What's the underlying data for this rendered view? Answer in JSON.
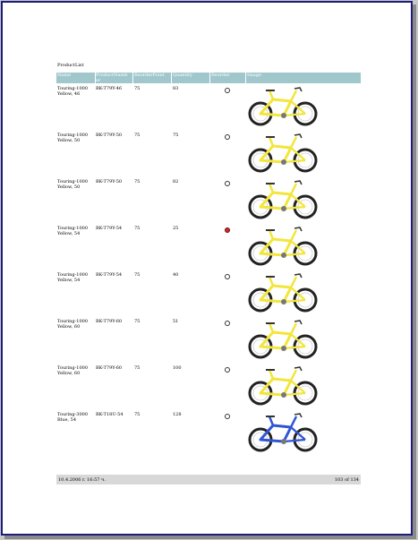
{
  "report": {
    "title": "ProductList",
    "columns": {
      "name": "Name",
      "product_number": "ProductNumb er",
      "reorder_point": "ReorderPoint",
      "quantity": "Quantity",
      "reorder": "Reorder",
      "image": "Image"
    },
    "rows": [
      {
        "name": "Touring-1000 Yellow, 46",
        "product_number": "BK-T79Y-46",
        "reorder_point": "75",
        "quantity": "83",
        "reorder": false,
        "bike_color": "yellow"
      },
      {
        "name": "Touring-1000 Yellow, 50",
        "product_number": "BK-T79Y-50",
        "reorder_point": "75",
        "quantity": "75",
        "reorder": false,
        "bike_color": "yellow"
      },
      {
        "name": "Touring-1000 Yellow, 50",
        "product_number": "BK-T79Y-50",
        "reorder_point": "75",
        "quantity": "82",
        "reorder": false,
        "bike_color": "yellow"
      },
      {
        "name": "Touring-1000 Yellow, 54",
        "product_number": "BK-T79Y-54",
        "reorder_point": "75",
        "quantity": "25",
        "reorder": true,
        "bike_color": "yellow"
      },
      {
        "name": "Touring-1000 Yellow, 54",
        "product_number": "BK-T79Y-54",
        "reorder_point": "75",
        "quantity": "40",
        "reorder": false,
        "bike_color": "yellow"
      },
      {
        "name": "Touring-1000 Yellow, 60",
        "product_number": "BK-T79Y-60",
        "reorder_point": "75",
        "quantity": "51",
        "reorder": false,
        "bike_color": "yellow"
      },
      {
        "name": "Touring-1000 Yellow, 60",
        "product_number": "BK-T79Y-60",
        "reorder_point": "75",
        "quantity": "100",
        "reorder": false,
        "bike_color": "yellow"
      },
      {
        "name": "Touring-3000 Blue, 54",
        "product_number": "BK-T18U-54",
        "reorder_point": "75",
        "quantity": "128",
        "reorder": false,
        "bike_color": "blue"
      }
    ],
    "footer": {
      "timestamp": "10.4.2006 r. 16:57 ч.",
      "page": "103 of 134"
    }
  },
  "colors": {
    "header_bg": "#9fc7cc",
    "footer_bg": "#d8d8d8",
    "border": "#1c1c7a",
    "reorder_flag": "#cc2a2a",
    "bike_yellow": "#f2e63a",
    "bike_blue": "#2f55d4"
  }
}
